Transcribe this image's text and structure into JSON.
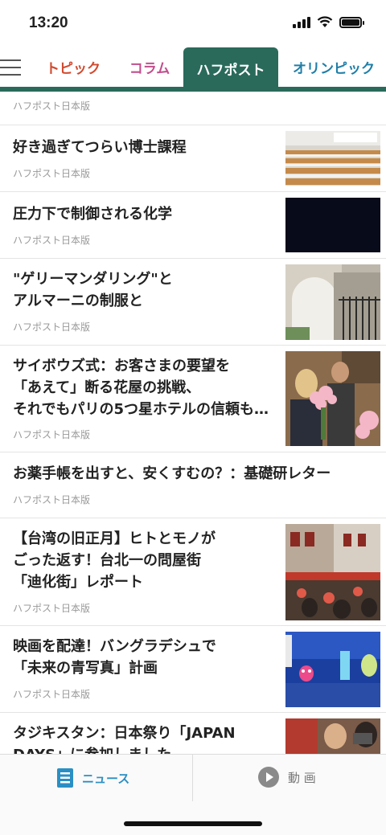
{
  "status_bar": {
    "time": "13:20",
    "battery_level": 1.0
  },
  "tabs": [
    {
      "label": "トピック",
      "color": "#d14a2f"
    },
    {
      "label": "コラム",
      "color": "#c24f8d"
    },
    {
      "label": "ハフポスト",
      "color": "#2a6a5b",
      "selected": true
    },
    {
      "label": "オリンピック",
      "color": "#1f7ea8"
    }
  ],
  "feed": {
    "top_source": "ハフポスト日本版",
    "items": [
      {
        "title": "好き過ぎてつらい博士課程",
        "source": "ハフポスト日本版",
        "thumbnail": "lecture-hall-photo"
      },
      {
        "title": "圧力下で制御される化学",
        "source": "ハフポスト日本版",
        "thumbnail": "dark-image"
      },
      {
        "title": "\"ゲリーマンダリング\"と\nアルマーニの制服と",
        "source": "ハフポスト日本版",
        "thumbnail": "building-gate-photo"
      },
      {
        "title": "サイボウズ式：お客さまの要望を\n「あえて」断る花屋の挑戦、\nそれでもパリの5つ星ホテルの信頼も…",
        "source": "ハフポスト日本版",
        "thumbnail": "florists-photo"
      },
      {
        "title": "お薬手帳を出すと、安くすむの？：基礎研レター",
        "source": "ハフポスト日本版",
        "thumbnail": ""
      },
      {
        "title": "【台湾の旧正月】ヒトとモノが\nごった返す！台北一の問屋街\n「迪化街」レポート",
        "source": "ハフポスト日本版",
        "thumbnail": "street-market-photo"
      },
      {
        "title": "映画を配達！バングラデシュで\n「未来の青写真」計画",
        "source": "ハフポスト日本版",
        "thumbnail": "projection-photo"
      },
      {
        "title": "タジキスタン：日本祭り「JAPAN\nDAYS」に参加しました",
        "source": "",
        "thumbnail": "festival-photo"
      }
    ]
  },
  "bottom_nav": {
    "news_label": "ニュース",
    "video_label": "動 画",
    "accent": "#2a8fc4"
  }
}
